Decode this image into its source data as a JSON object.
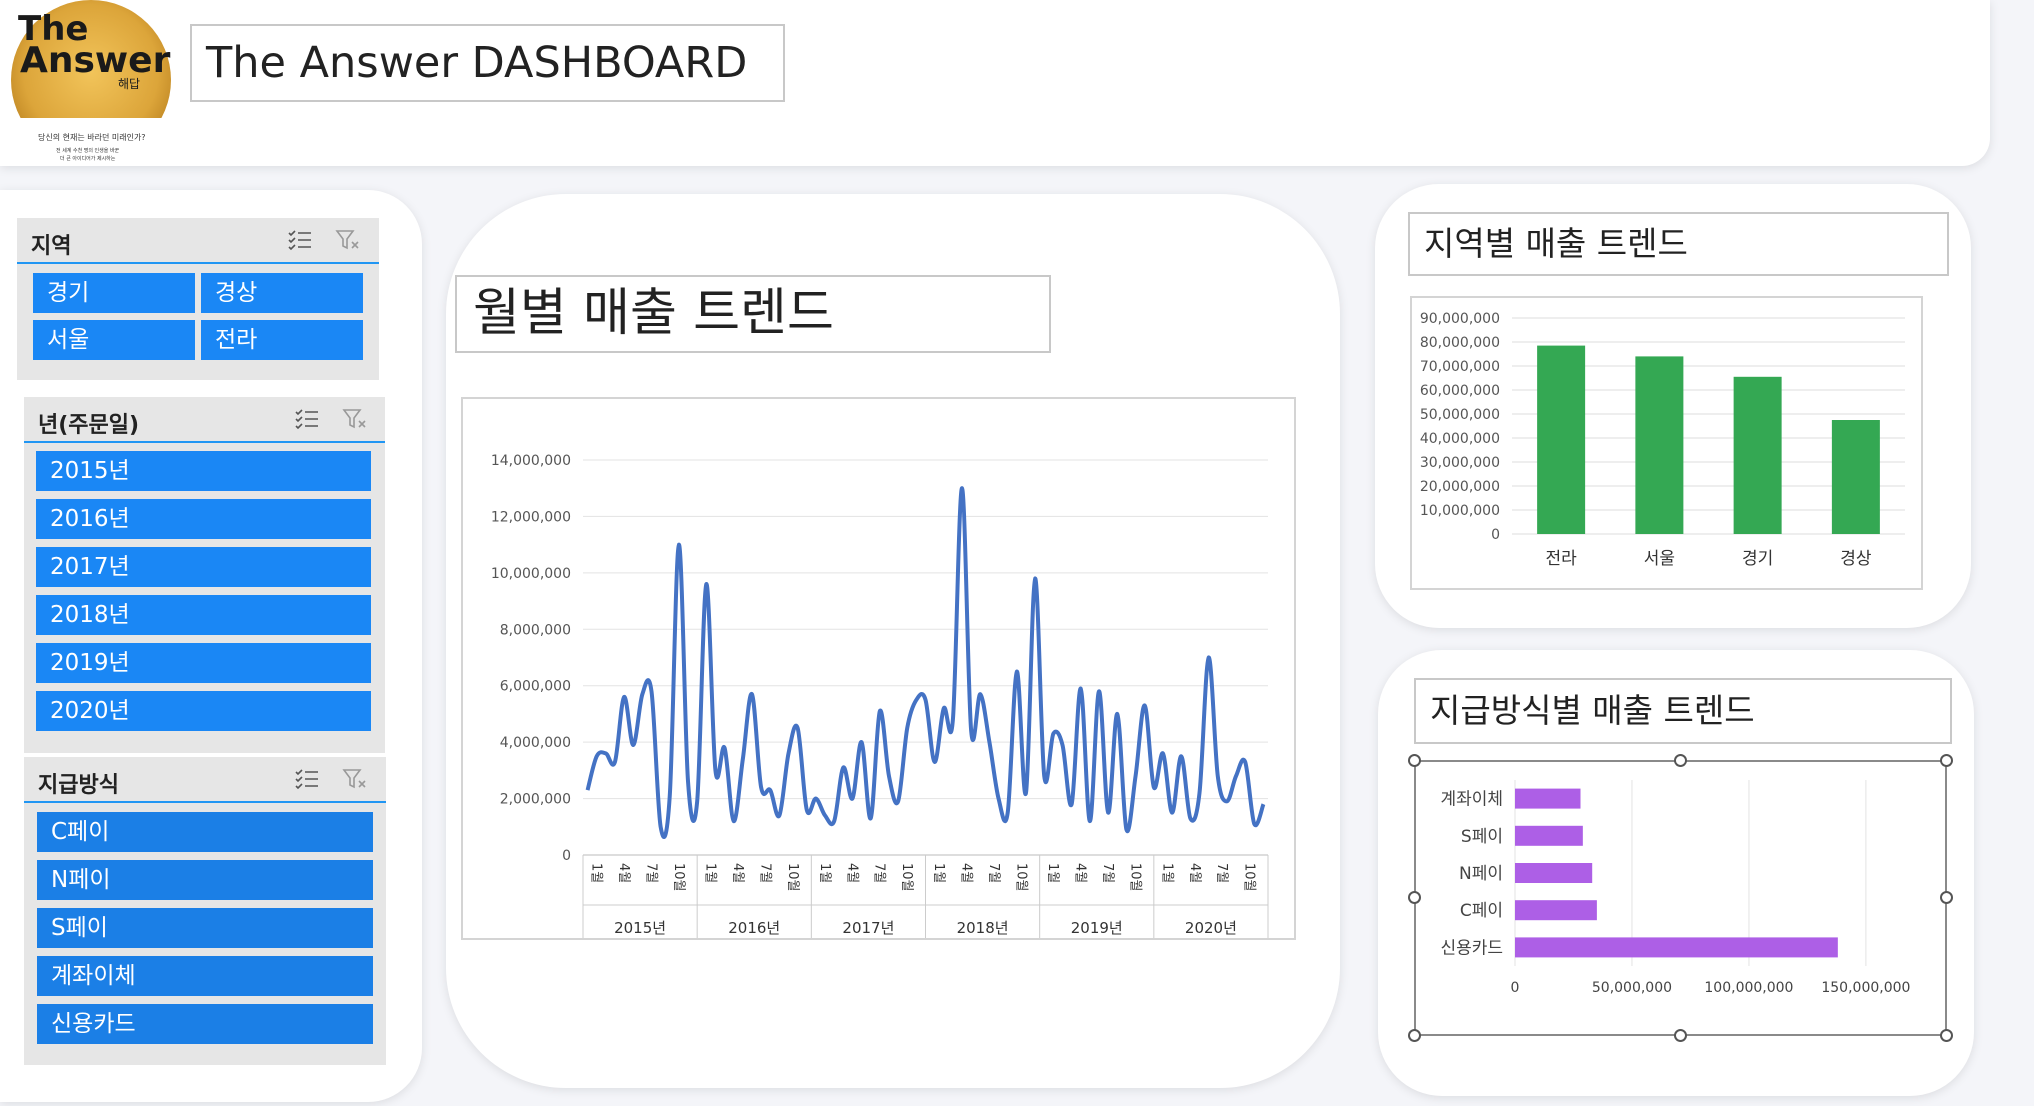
{
  "header": {
    "title": "The Answer DASHBOARD",
    "logo": {
      "line1": "The",
      "line2": "Answer",
      "sub": "해답",
      "caption1": "당신의 현재는 바라던 미래인가?",
      "caption2": "전 세계 수천 명의 인생을 바꾼",
      "caption3": "더 큰 아이디어가 제시하는"
    }
  },
  "slicers": {
    "region": {
      "title": "지역",
      "items": [
        "경기",
        "경상",
        "서울",
        "전라"
      ]
    },
    "year": {
      "title": "년(주문일)",
      "items": [
        "2015년",
        "2016년",
        "2017년",
        "2018년",
        "2019년",
        "2020년"
      ]
    },
    "payment": {
      "title": "지급방식",
      "items": [
        "C페이",
        "N페이",
        "S페이",
        "계좌이체",
        "신용카드"
      ]
    }
  },
  "colors": {
    "slicer_button": "#1a87f5",
    "line": "#4472c4",
    "bar_green": "#34a853",
    "bar_purple": "#ad5fe6"
  },
  "chart_data": [
    {
      "title": "월별 매출 트렌드",
      "type": "line",
      "line_smooth": true,
      "year_groups": [
        "2015년",
        "2016년",
        "2017년",
        "2018년",
        "2019년",
        "2020년"
      ],
      "month_tick_labels": [
        "1월",
        "4월",
        "7월",
        "10월"
      ],
      "yticks": [
        "0",
        "2,000,000",
        "4,000,000",
        "6,000,000",
        "8,000,000",
        "10,000,000",
        "12,000,000",
        "14,000,000"
      ],
      "ylim": [
        0,
        14000000
      ],
      "grid": true,
      "series": [
        {
          "values": [
            2300000,
            3500000,
            3600000,
            3300000,
            5600000,
            3900000,
            5700000,
            5800000,
            1000000,
            2100000,
            11000000,
            2600000,
            1900000,
            9600000,
            3000000,
            3800000,
            1200000,
            3400000,
            5700000,
            2400000,
            2300000,
            1400000,
            3600000,
            4500000,
            1600000,
            2000000,
            1400000,
            1200000,
            3100000,
            2000000,
            4000000,
            1300000,
            5100000,
            2800000,
            1900000,
            4500000,
            5500000,
            5500000,
            3300000,
            5200000,
            4800000,
            13000000,
            4400000,
            5700000,
            4000000,
            2000000,
            1500000,
            6500000,
            2200000,
            9800000,
            2800000,
            4300000,
            3900000,
            1800000,
            5900000,
            1200000,
            5800000,
            1500000,
            5000000,
            900000,
            2800000,
            5300000,
            2400000,
            3600000,
            1500000,
            3500000,
            1300000,
            2200000,
            7000000,
            2800000,
            1900000,
            2800000,
            3300000,
            1100000,
            1800000
          ]
        }
      ]
    },
    {
      "title": "지역별 매출 트렌드",
      "type": "bar",
      "categories": [
        "전라",
        "서울",
        "경기",
        "경상"
      ],
      "values": [
        78500000,
        74000000,
        65500000,
        47500000
      ],
      "yticks": [
        "0",
        "10,000,000",
        "20,000,000",
        "30,000,000",
        "40,000,000",
        "50,000,000",
        "60,000,000",
        "70,000,000",
        "80,000,000",
        "90,000,000"
      ],
      "ylim": [
        0,
        90000000
      ],
      "grid": true
    },
    {
      "title": "지급방식별 매출 트렌드",
      "type": "bar",
      "orientation": "horizontal",
      "categories": [
        "계좌이체",
        "S페이",
        "N페이",
        "C페이",
        "신용카드"
      ],
      "values": [
        28000000,
        29000000,
        33000000,
        35000000,
        138000000
      ],
      "xticks": [
        "0",
        "50,000,000",
        "100,000,000",
        "150,000,000"
      ],
      "xlim": [
        0,
        165000000
      ],
      "grid": true
    }
  ]
}
